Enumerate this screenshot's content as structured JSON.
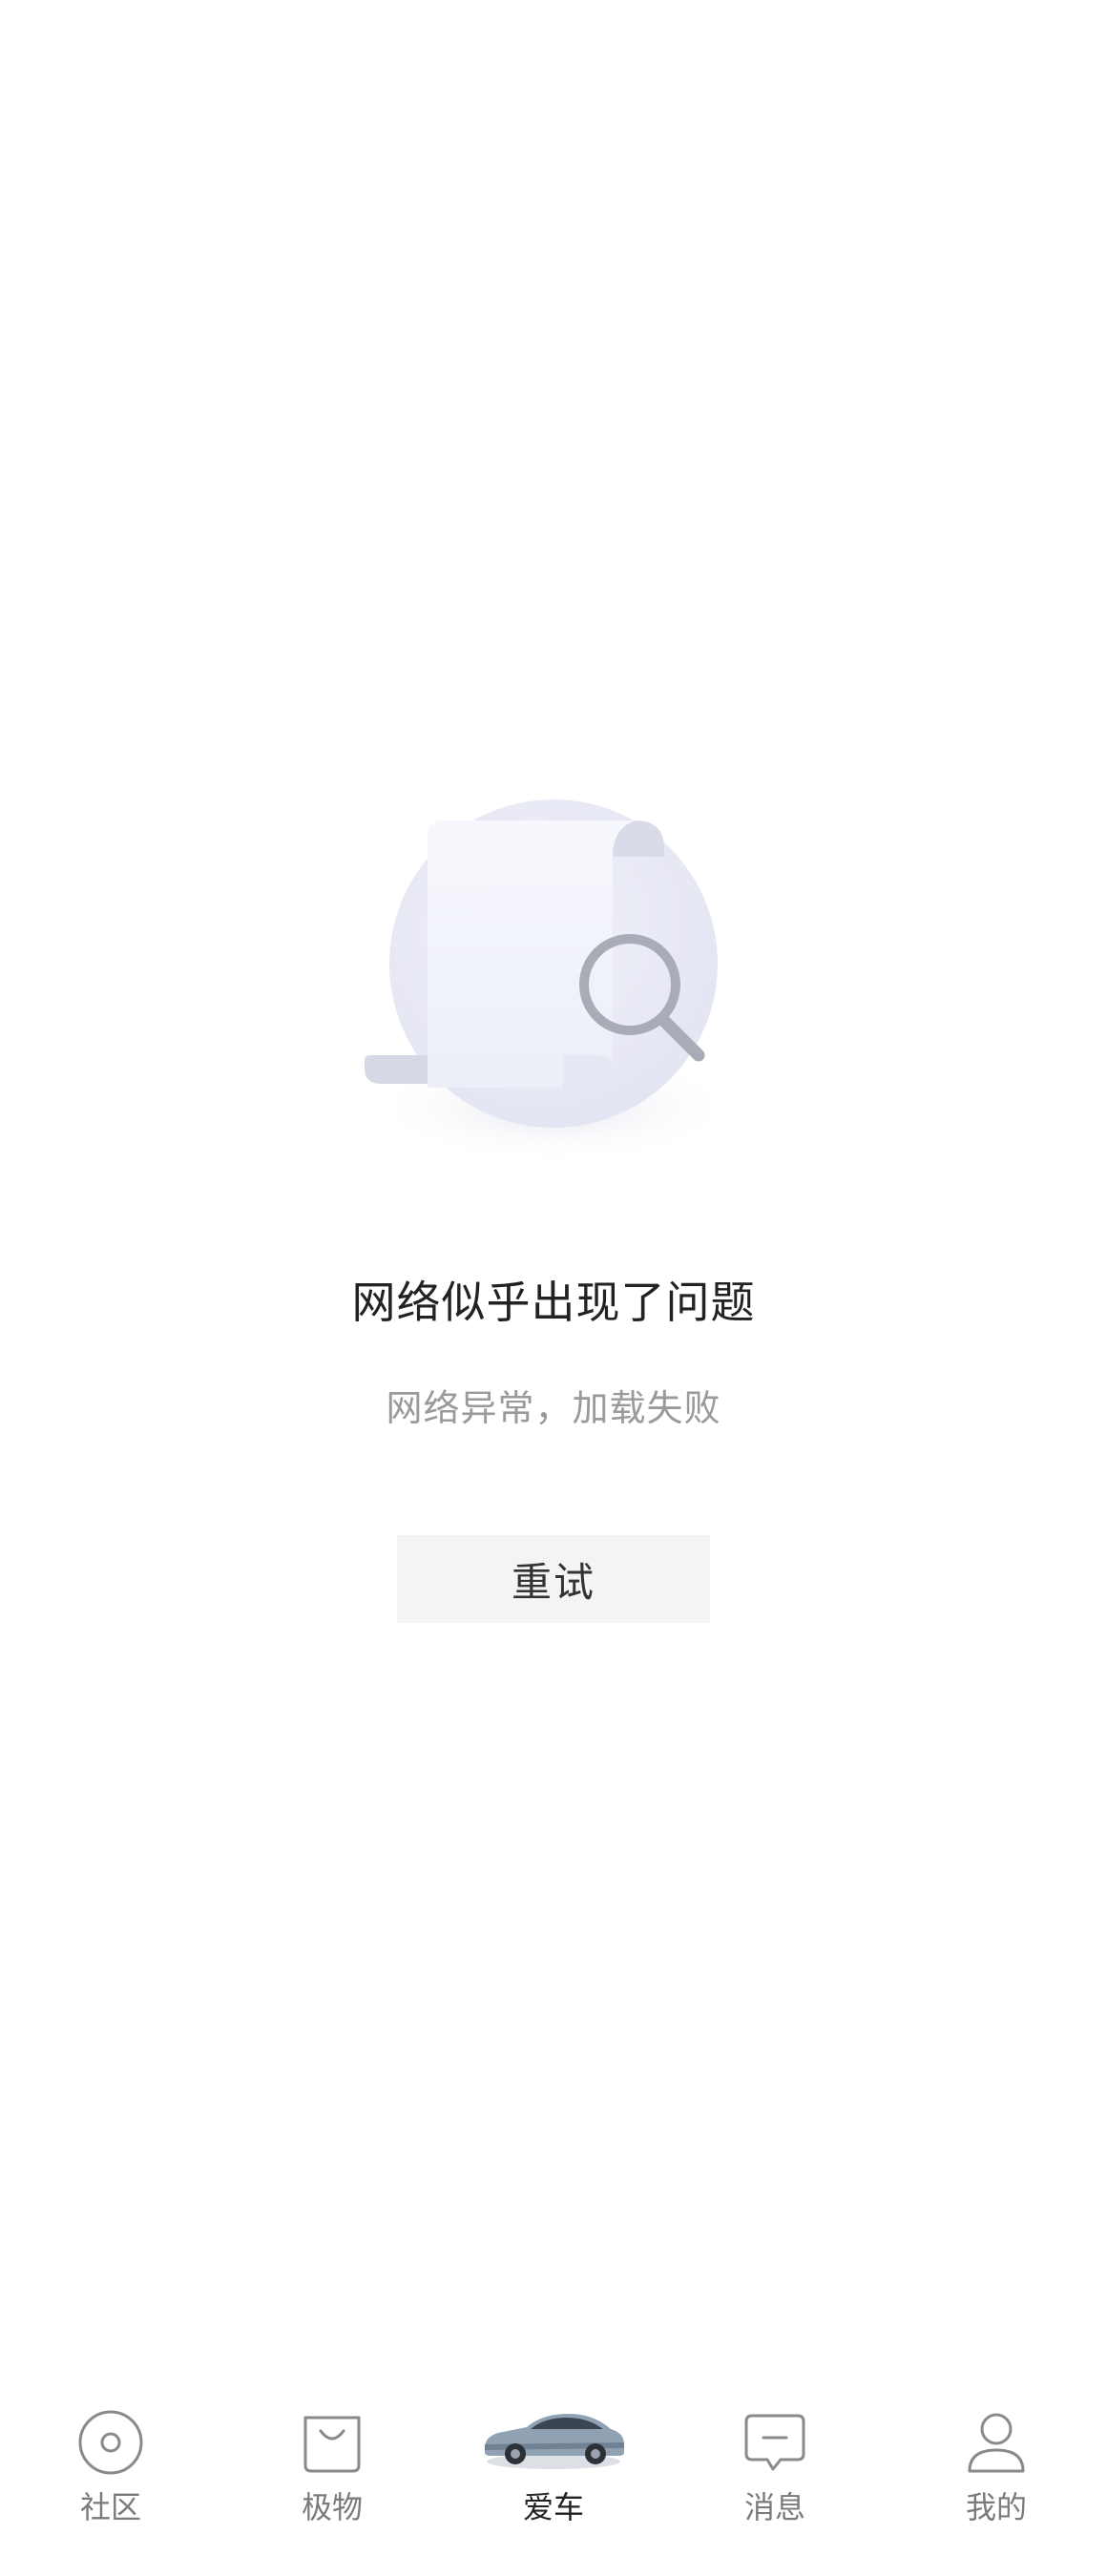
{
  "error": {
    "title": "网络似乎出现了问题",
    "subtitle": "网络异常，加载失败",
    "retry_label": "重试",
    "illustration_icon": "document-search-icon"
  },
  "tabs": [
    {
      "label": "社区",
      "icon": "community-icon",
      "active": false
    },
    {
      "label": "极物",
      "icon": "shopping-bag-icon",
      "active": false
    },
    {
      "label": "爱车",
      "icon": "car-image",
      "active": true
    },
    {
      "label": "消息",
      "icon": "message-icon",
      "active": false
    },
    {
      "label": "我的",
      "icon": "profile-icon",
      "active": false
    }
  ],
  "colors": {
    "title_text": "#222222",
    "subtitle_text": "#9a9a9a",
    "button_bg": "#f4f4f5",
    "tab_inactive": "#7a7a7a",
    "tab_active": "#222222",
    "illustration_circle": "#ebecf6"
  }
}
